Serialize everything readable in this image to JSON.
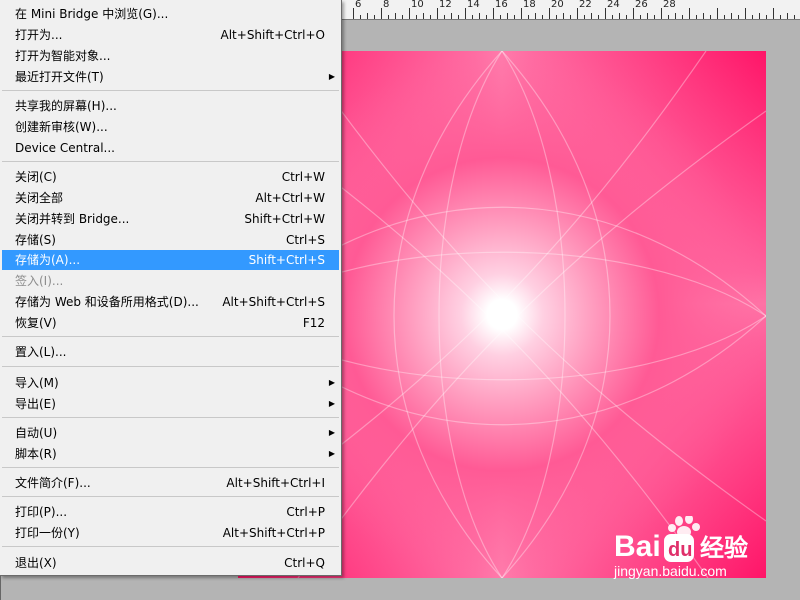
{
  "ruler": {
    "labels": [
      "6",
      "8",
      "10",
      "12",
      "14",
      "16",
      "18",
      "20",
      "22",
      "24",
      "26",
      "28"
    ]
  },
  "menu": {
    "items": [
      {
        "label": "在 Mini Bridge 中浏览(G)...",
        "shortcut": "",
        "submenu": false,
        "state": "normal"
      },
      {
        "label": "打开为...",
        "shortcut": "Alt+Shift+Ctrl+O",
        "submenu": false,
        "state": "normal"
      },
      {
        "label": "打开为智能对象...",
        "shortcut": "",
        "submenu": false,
        "state": "normal"
      },
      {
        "label": "最近打开文件(T)",
        "shortcut": "",
        "submenu": true,
        "state": "normal"
      },
      {
        "label": "共享我的屏幕(H)...",
        "shortcut": "",
        "submenu": false,
        "state": "normal"
      },
      {
        "label": "创建新审核(W)...",
        "shortcut": "",
        "submenu": false,
        "state": "normal"
      },
      {
        "label": "Device Central...",
        "shortcut": "",
        "submenu": false,
        "state": "normal"
      },
      {
        "label": "关闭(C)",
        "shortcut": "Ctrl+W",
        "submenu": false,
        "state": "normal"
      },
      {
        "label": "关闭全部",
        "shortcut": "Alt+Ctrl+W",
        "submenu": false,
        "state": "normal"
      },
      {
        "label": "关闭并转到 Bridge...",
        "shortcut": "Shift+Ctrl+W",
        "submenu": false,
        "state": "normal"
      },
      {
        "label": "存储(S)",
        "shortcut": "Ctrl+S",
        "submenu": false,
        "state": "normal"
      },
      {
        "label": "存储为(A)...",
        "shortcut": "Shift+Ctrl+S",
        "submenu": false,
        "state": "highlighted"
      },
      {
        "label": "签入(I)...",
        "shortcut": "",
        "submenu": false,
        "state": "disabled"
      },
      {
        "label": "存储为 Web 和设备所用格式(D)...",
        "shortcut": "Alt+Shift+Ctrl+S",
        "submenu": false,
        "state": "normal"
      },
      {
        "label": "恢复(V)",
        "shortcut": "F12",
        "submenu": false,
        "state": "normal"
      },
      {
        "label": "置入(L)...",
        "shortcut": "",
        "submenu": false,
        "state": "normal"
      },
      {
        "label": "导入(M)",
        "shortcut": "",
        "submenu": true,
        "state": "normal"
      },
      {
        "label": "导出(E)",
        "shortcut": "",
        "submenu": true,
        "state": "normal"
      },
      {
        "label": "自动(U)",
        "shortcut": "",
        "submenu": true,
        "state": "normal"
      },
      {
        "label": "脚本(R)",
        "shortcut": "",
        "submenu": true,
        "state": "normal"
      },
      {
        "label": "文件简介(F)...",
        "shortcut": "Alt+Shift+Ctrl+I",
        "submenu": false,
        "state": "normal"
      },
      {
        "label": "打印(P)...",
        "shortcut": "Ctrl+P",
        "submenu": false,
        "state": "normal"
      },
      {
        "label": "打印一份(Y)",
        "shortcut": "Alt+Shift+Ctrl+P",
        "submenu": false,
        "state": "normal"
      },
      {
        "label": "退出(X)",
        "shortcut": "Ctrl+Q",
        "submenu": false,
        "state": "normal"
      }
    ],
    "submenu_arrow": "▶"
  },
  "watermark": {
    "brand": "Bai",
    "brand_tail": "经验",
    "url": "jingyan.baidu.com"
  },
  "colors": {
    "highlight": "#3399ff",
    "canvas_pink": "#ff1568",
    "menu_bg": "#f0f0f0",
    "disabled_text": "#8d8d8d"
  }
}
